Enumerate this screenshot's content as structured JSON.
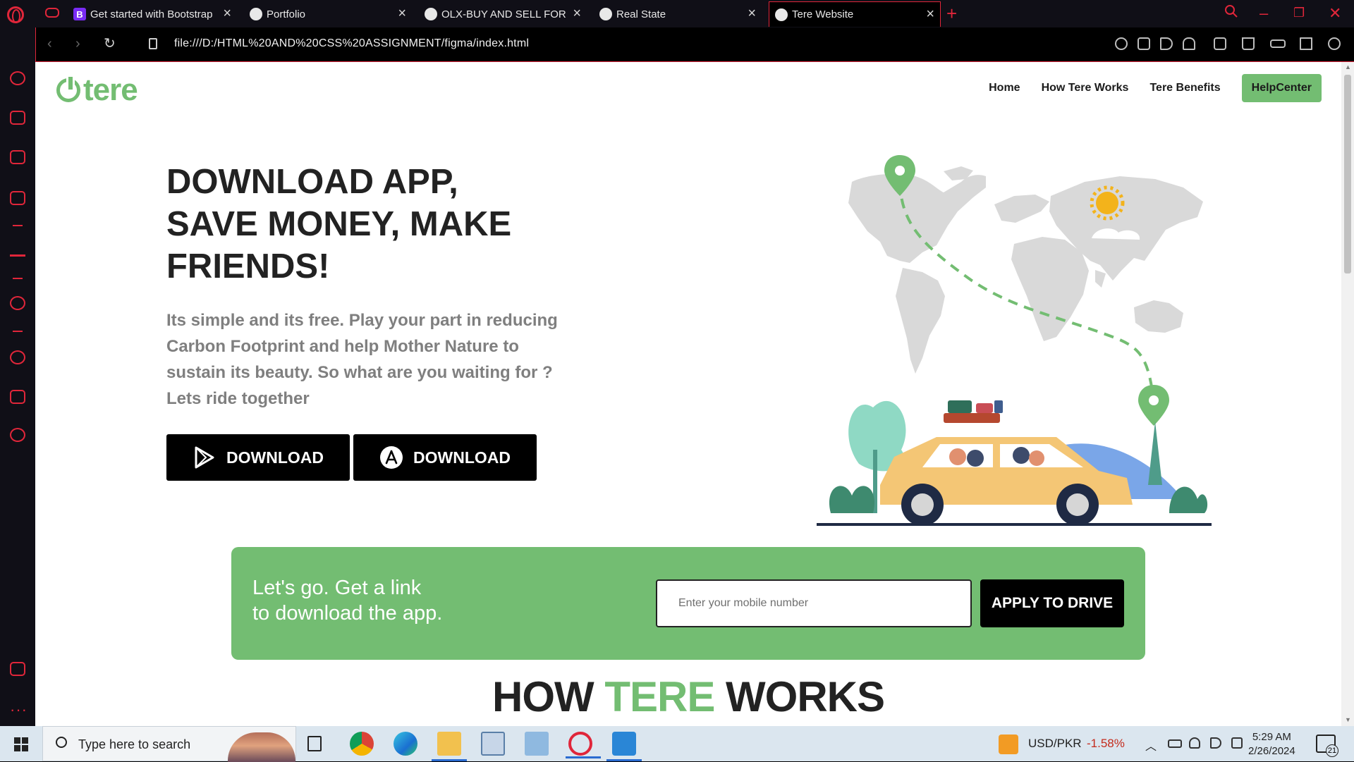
{
  "browser": {
    "tabs": [
      {
        "label": "Get started with Bootstrap",
        "favicon": "bootstrap-icon",
        "active": false
      },
      {
        "label": "Portfolio",
        "favicon": "globe-icon",
        "active": false
      },
      {
        "label": "OLX-BUY AND SELL FOR FREE",
        "favicon": "globe-icon",
        "active": false
      },
      {
        "label": "Real State",
        "favicon": "globe-icon",
        "active": false
      },
      {
        "label": "Tere Website",
        "favicon": "globe-icon",
        "active": true
      }
    ],
    "new_tab": "+",
    "url": "file:///D:/HTML%20AND%20CSS%20ASSIGNMENT/figma/index.html",
    "accent_color": "#e0263a"
  },
  "site": {
    "logo_text": "tere",
    "brand_color": "#73bd72",
    "nav": {
      "home": "Home",
      "how": "How Tere Works",
      "benefits": "Tere Benefits",
      "help": "HelpCenter"
    },
    "hero": {
      "title_line1": "DOWNLOAD APP,",
      "title_line2": "SAVE MONEY, MAKE",
      "title_line3": "FRIENDS!",
      "text": "Its simple and its free. Play your part in reducing Carbon Footprint and help Mother Nature to sustain its beauty. So what are you waiting for ? Lets ride together",
      "download_android": "DOWNLOAD",
      "download_ios": "DOWNLOAD"
    },
    "banner": {
      "line1": "Let's go. Get a link",
      "line2": "to download the app.",
      "placeholder": "Enter your mobile number",
      "apply": "APPLY TO DRIVE"
    },
    "how_section": {
      "word1": "HOW",
      "word2": "TERE",
      "word3": "WORKS"
    }
  },
  "taskbar": {
    "search_placeholder": "Type here to search",
    "currency": "USD/PKR",
    "currency_change": "-1.58%",
    "time": "5:29 AM",
    "date": "2/26/2024",
    "notifications": "21"
  }
}
